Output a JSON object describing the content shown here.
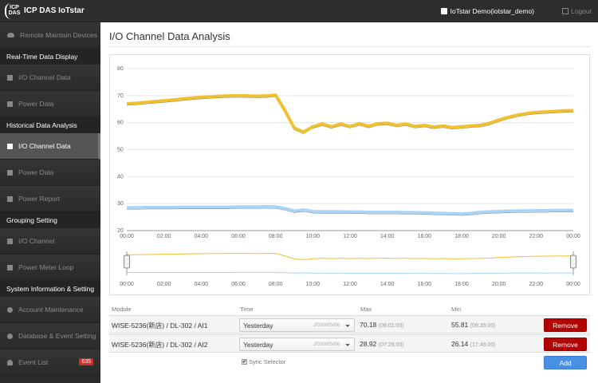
{
  "header": {
    "logo_text": "ICP DAS",
    "brand": "ICP DAS IoTstar",
    "user": "IoTstar Demo(iotstar_demo)",
    "logout": "Logout"
  },
  "sidebar": {
    "remote": "Remote Maintain Devices",
    "realtime_header": "Real-Time Data Display",
    "rt_io": "I/O Channel Data",
    "rt_power": "Power Data",
    "hist_header": "Historical Data Analysis",
    "h_io": "I/O Channel Data",
    "h_power": "Power Data",
    "h_report": "Power Report",
    "group_header": "Grouping Setting",
    "g_io": "I/O Channel",
    "g_loop": "Power Meter Loop",
    "sys_header": "System Information & Setting",
    "s_account": "Account Maintenance",
    "s_db": "Database & Event Setting",
    "s_event": "Event List",
    "event_count": "635"
  },
  "page": {
    "title": "I/O Channel Data Analysis"
  },
  "table": {
    "headers": {
      "module": "Module",
      "time": "Time",
      "max": "Max",
      "min": "Min"
    },
    "rows": [
      {
        "module": "WISE-5236(新店) / DL-302 / AI1",
        "time": "Yesterday",
        "date": "2020/05/06",
        "max": "70.18",
        "max_time": "(08:01:00)",
        "min": "55.81",
        "min_time": "(09:35:00)",
        "remove": "Remove"
      },
      {
        "module": "WISE-5236(新店) / DL-302 / AI2",
        "time": "Yesterday",
        "date": "2020/05/06",
        "max": "28.92",
        "max_time": "(07:29:00)",
        "min": "26.14",
        "min_time": "(17:46:00)",
        "remove": "Remove"
      }
    ],
    "sync": "Sync Selector",
    "sync_checked": true,
    "add": "Add"
  },
  "chart_data": {
    "type": "line",
    "ylim": [
      20,
      80
    ],
    "yticks": [
      "20",
      "30",
      "40",
      "50",
      "60",
      "70",
      "80"
    ],
    "xticks": [
      "00:00",
      "02:00",
      "04:00",
      "06:00",
      "08:00",
      "10:00",
      "12:00",
      "14:00",
      "16:00",
      "18:00",
      "20:00",
      "22:00",
      "00:00"
    ],
    "x_interval_hours": 0.5,
    "grid": true,
    "navigator": true,
    "series": [
      {
        "color": "#f0c030",
        "values": [
          67,
          67.2,
          67.5,
          67.8,
          68.1,
          68.4,
          68.8,
          69.1,
          69.4,
          69.6,
          69.8,
          69.9,
          70,
          69.9,
          69.8,
          69.9,
          70.2,
          64.5,
          58,
          56.5,
          58.5,
          59.5,
          58.5,
          59.5,
          58.6,
          59.6,
          58.7,
          59.6,
          59.8,
          59,
          59.5,
          58.6,
          59,
          58.4,
          58.8,
          58.2,
          58.5,
          58.8,
          59,
          59.8,
          61,
          62,
          62.8,
          63.4,
          63.8,
          64,
          64.2,
          64.4,
          64.5
        ]
      },
      {
        "color": "#a9d4f5",
        "values": [
          28.5,
          28.5,
          28.6,
          28.6,
          28.6,
          28.6,
          28.7,
          28.7,
          28.7,
          28.7,
          28.7,
          28.7,
          28.8,
          28.8,
          28.8,
          28.9,
          28.8,
          28.2,
          27.3,
          27.7,
          27.1,
          27,
          27,
          27,
          26.9,
          26.9,
          26.8,
          26.8,
          26.8,
          26.8,
          26.7,
          26.7,
          26.6,
          26.5,
          26.4,
          26.3,
          26.2,
          26.4,
          26.8,
          27,
          27.1,
          27.2,
          27.3,
          27.3,
          27.4,
          27.4,
          27.5,
          27.5,
          27.5
        ]
      }
    ]
  }
}
